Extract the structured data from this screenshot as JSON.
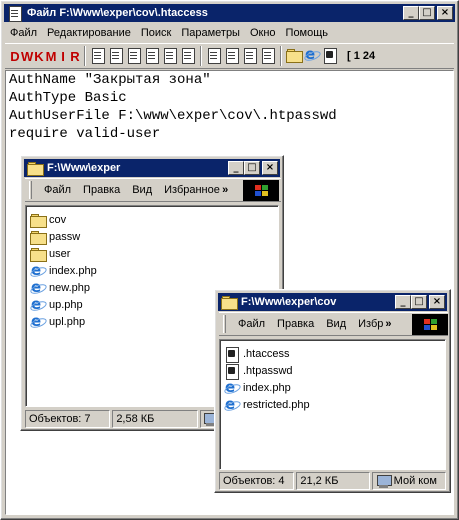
{
  "main_window": {
    "title": "Файл F:\\Www\\exper\\cov\\.htaccess",
    "title_buttons": [
      "_",
      "□",
      "×"
    ],
    "menu": [
      "Файл",
      "Редактирование",
      "Поиск",
      "Параметры",
      "Окно",
      "Помощь"
    ],
    "toolbar_letters": [
      "D",
      "W",
      "K",
      "M",
      "I",
      "R"
    ],
    "toolbar_status": "[ 1  24",
    "editor_lines": [
      "AuthName \"Закрытая зона\"",
      "AuthType Basic",
      "AuthUserFile F:\\www\\exper\\cov\\.htpasswd",
      "require valid-user"
    ]
  },
  "explorer1": {
    "title": "F:\\Www\\exper",
    "menu": [
      "Файл",
      "Правка",
      "Вид",
      "Избранное"
    ],
    "more": "»",
    "items": [
      {
        "name": "cov",
        "icon": "folder-icon"
      },
      {
        "name": "passw",
        "icon": "folder-icon"
      },
      {
        "name": "user",
        "icon": "folder-icon"
      },
      {
        "name": "index.php",
        "icon": "php-file-icon"
      },
      {
        "name": "new.php",
        "icon": "php-file-icon"
      },
      {
        "name": "up.php",
        "icon": "php-file-icon"
      },
      {
        "name": "upl.php",
        "icon": "php-file-icon"
      }
    ],
    "status": {
      "objects": "Объектов: 7",
      "size": "2,58 КБ"
    }
  },
  "explorer2": {
    "title": "F:\\Www\\exper\\cov",
    "menu": [
      "Файл",
      "Правка",
      "Вид",
      "Избр"
    ],
    "more": "»",
    "items": [
      {
        "name": ".htaccess",
        "icon": "config-file-icon"
      },
      {
        "name": ".htpasswd",
        "icon": "config-file-icon"
      },
      {
        "name": "index.php",
        "icon": "php-file-icon"
      },
      {
        "name": "restricted.php",
        "icon": "php-file-icon"
      }
    ],
    "status": {
      "objects": "Объектов: 4",
      "size": "21,2 КБ",
      "location": "Мой ком"
    }
  },
  "colors": {
    "titlebar": "#0a246a",
    "face": "#d4d0c8",
    "toolbar_letters": "#c00000"
  }
}
